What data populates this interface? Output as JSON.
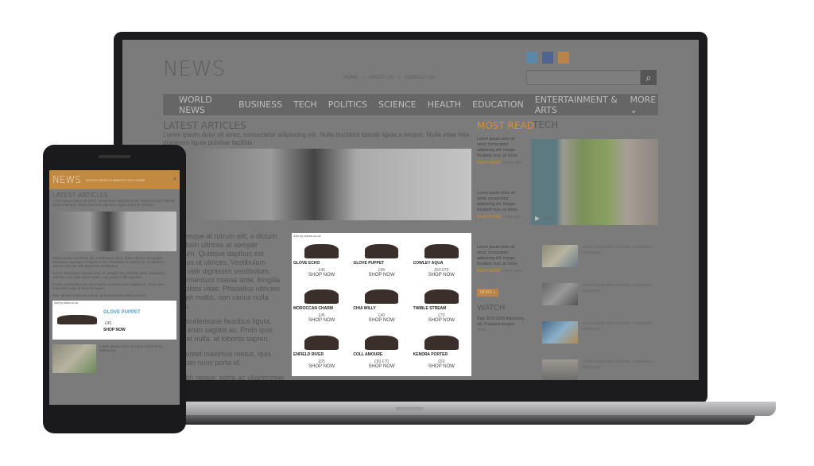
{
  "site": {
    "logo": "NEWS",
    "top_links": [
      "HOME",
      "ABOUT US",
      "CONTACT US"
    ],
    "social_icons": [
      "twitter-icon",
      "facebook-icon",
      "rss-icon"
    ],
    "search_placeholder": "",
    "accent": "#d0913c"
  },
  "nav": {
    "items": [
      "WORLD NEWS",
      "BUSINESS",
      "TECH",
      "POLITICS",
      "SCIENCE",
      "HEALTH",
      "EDUCATION",
      "ENTERTAINMENT & ARTS"
    ],
    "more": "MORE ⌄"
  },
  "latest": {
    "title": "LATEST ARTICLES",
    "intro": "Lorem ipsum dolor sit amet, consectetur adipiscing elit. Nulla tincidunt blandit ligula a tempor. Nulla vitae felis dignissim ligula pulvinar facilisis.",
    "paragraphs": [
      "Pellentesque at rutrum elit, a dictum arcu. Etiam ultrices at semper bibendum. Quisque dapibus est. Phasellus ut ultrices. Vestibulum ultrices velit dignissim vestibulum. Nam fermentum massa ante, fringilla sem facilisis vitae. Phasellus ultricies urna eget mattis, non varius nulla egestas.",
      "Donec scelerisque faucibus ligula, sagittis enim sagittis ac. Proin quis imperdiet nulla, at lobortis sapien.",
      "Nam laoreet maximus metus, quis accumsan nunc porta id.",
      "Nam nibh neque, porta ac ullamcorper et, convallis quis elit. Mauris eu lacus sed magna."
    ]
  },
  "ad": {
    "label": "Ads by clarks.co.uk",
    "items": [
      {
        "name": "GLOVE ECHO",
        "price": "£45",
        "cta": "SHOP NOW"
      },
      {
        "name": "GLOVE PUPPET",
        "price": "£45",
        "cta": "SHOP NOW"
      },
      {
        "name": "COWLEY AQUA",
        "price": "£60 £70",
        "cta": "SHOP NOW"
      },
      {
        "name": "MOROCCAN CHARM",
        "price": "£45",
        "cta": "SHOP NOW"
      },
      {
        "name": "CHIA WILLY",
        "price": "£40",
        "cta": "SHOP NOW"
      },
      {
        "name": "TWIBLE STREAM",
        "price": "£70",
        "cta": "SHOP NOW"
      },
      {
        "name": "ENFIELD RIVER",
        "price": "£65",
        "cta": "SHOP NOW"
      },
      {
        "name": "COLL AMOURE",
        "price": "£60 £70",
        "cta": "SHOP NOW"
      },
      {
        "name": "KENDRA PORTER",
        "price": "£60",
        "cta": "SHOP NOW"
      }
    ]
  },
  "most_read": {
    "title": "MOST READ",
    "items": [
      {
        "text": "Lorem ipsum dolor sit amet, consectetur adipiscing elit. Integer tincidunt nunc ac tortor.",
        "more": "READ MORE",
        "time": "1 hour ago"
      },
      {
        "text": "Lorem ipsum dolor sit amet, consectetur adipiscing elit. Integer tincidunt nunc ac tortor.",
        "more": "READ MORE",
        "time": "1 hour ago"
      },
      {
        "text": "Lorem ipsum dolor sit amet, consectetur adipiscing elit. Integer tincidunt nunc ac tortor.",
        "more": "READ MORE",
        "time": "1 hour ago"
      }
    ],
    "more_button": "MORE »"
  },
  "watch": {
    "title": "WATCH",
    "text": "Duis 2015 2016 Adipiscing elit. Praesent tempus",
    "link": "more"
  },
  "tech": {
    "title": "TECH",
    "video_time": "0:40",
    "items": [
      "Lorem ipsum dolor sit amet, consectetur adipiscing.",
      "Lorem ipsum dolor sit amet, consectetur adipiscing.",
      "Lorem ipsum dolor sit amet, consectetur adipiscing.",
      "Lorem ipsum dolor sit amet, consectetur adipiscing."
    ]
  },
  "phone": {
    "logo": "NEWS",
    "nav": "WORLD NEWS  BUSINESS  TECH  MORE",
    "title": "LATEST ARTICLES",
    "intro": "Lorem ipsum dolor sit amet, consectetur adipiscing elit. Nulla tincidunt blandit ligula a tempor. Nulla vitae felis dignissim ligula pulvinar facilisis.",
    "paragraphs": [
      "Pellentesque at rutrum elit, a bibendum arcu. Etiam ultrices at semper bibendum. Quisque at dapibus est. Phasellus ut mauris mi. Vestibulum ultrices arcu ac velit dignissim vestibulum.",
      "Donec fermentum massa ante, ac fringilla sem facilisis vitae. Phasellus ultricies urna eget tortor mattis, non varius nulla egestas.",
      "Donec scelerisque faucibus ligula, at mollis enim sagittis ac. Proin quis imperdiet nulla, at lobortis sapien.",
      "Nam laoreet maximus metus, quis accumsan nunc porta id."
    ],
    "ad": {
      "label": "Ads by clarks.co.uk",
      "name": "GLOVE PUPPET",
      "price": "£45",
      "cta": "SHOP NOW"
    },
    "teaser": "Lorem ipsum dolor sit amet, consectetur adipiscing."
  }
}
